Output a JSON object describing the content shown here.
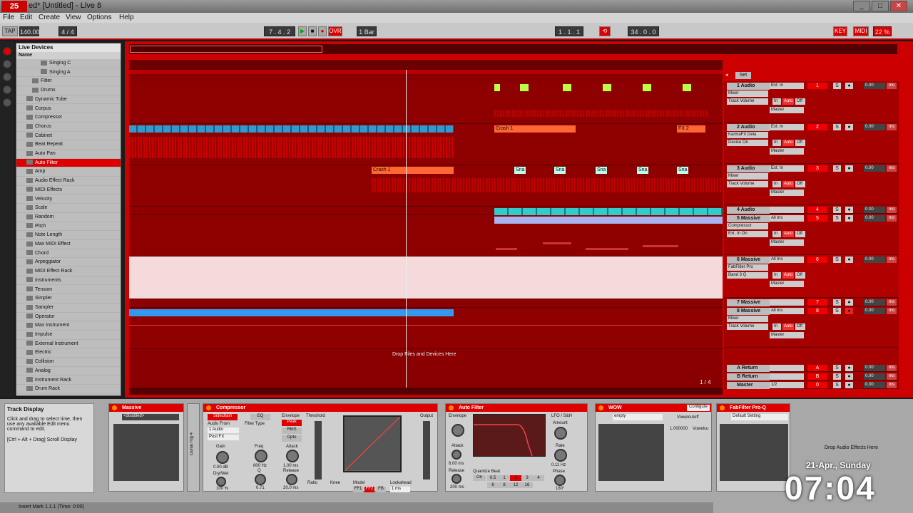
{
  "window": {
    "title": "ed* [Untitled] - Live 8",
    "logo": "25",
    "buttons": [
      "_",
      "□",
      "✕"
    ]
  },
  "menu": [
    "File",
    "Edit",
    "Create",
    "View",
    "Options",
    "Help"
  ],
  "transport": {
    "tap": "TAP",
    "tempo": "140.00",
    "time_sig": "4 / 4",
    "position": "7 . 4 . 2",
    "ovr": "OVR",
    "quantize": "1 Bar",
    "loop_start": "1 . 1 . 1",
    "loop_length": "34 . 0 . 0",
    "key": "KEY",
    "midi": "MIDI",
    "cpu": "22 %"
  },
  "browser": {
    "header": "Live Devices",
    "column": "Name",
    "items": [
      "Singing C",
      "Singing A",
      "Filter",
      "Drums",
      "Dynamic Tube",
      "Corpus",
      "Compressor",
      "Chorus",
      "Cabinet",
      "Beat Repeat",
      "Auto Pan",
      "Auto Filter",
      "Amp",
      "Audio Effect Rack",
      "MIDI Effects",
      "Velocity",
      "Scale",
      "Random",
      "Pitch",
      "Note Length",
      "Max MIDI Effect",
      "Chord",
      "Arpeggiator",
      "MIDI Effect Rack",
      "Instruments",
      "Tension",
      "Simpler",
      "Sampler",
      "Operator",
      "Max Instrument",
      "Impulse",
      "External Instrument",
      "Electric",
      "Collision",
      "Analog",
      "Instrument Rack",
      "Drum Rack"
    ],
    "selected": "Auto Filter"
  },
  "clips": {
    "crash1_a": "Crash 1",
    "crash1_b": "Crash 1",
    "fx2": "FX 2",
    "snare": "Sna"
  },
  "arrangement": {
    "drop_hint": "Drop Files and Devices Here",
    "page": "1 / 4",
    "set": "Set"
  },
  "tracks": [
    {
      "name": "1 Audio",
      "num": "1",
      "io1": "Ext. In",
      "io2": "Mixer",
      "io3": "Track Volume",
      "val": "0.00"
    },
    {
      "name": "2 Audio",
      "num": "2",
      "io1": "Ext. In",
      "io2": "KarmaFX Dela",
      "io3": "Device On",
      "val": "0.00"
    },
    {
      "name": "3 Audio",
      "num": "3",
      "io1": "Ext. In",
      "io2": "Mixer",
      "io3": "Track Volume",
      "val": "0.00"
    },
    {
      "name": "4 Audio",
      "num": "4",
      "io1": "",
      "io2": "",
      "io3": "",
      "val": "0.00"
    },
    {
      "name": "5 Massive",
      "num": "5",
      "io1": "All Ins",
      "io2": "Compressor",
      "io3": "Ext. In On",
      "val": "0.00"
    },
    {
      "name": "6 Massive",
      "num": "6",
      "io1": "All Ins",
      "io2": "FabFilter Pro",
      "io3": "Band 3 Q",
      "val": "0.00"
    },
    {
      "name": "7 Massive",
      "num": "7",
      "io1": "",
      "io2": "",
      "io3": "",
      "val": "0.00"
    },
    {
      "name": "8 Massive",
      "num": "8",
      "io1": "All Ins",
      "io2": "Mixer",
      "io3": "Track Volume",
      "val": "0.00"
    },
    {
      "name": "A Return",
      "num": "A",
      "io1": "",
      "io2": "",
      "io3": "",
      "val": "0.00"
    },
    {
      "name": "B Return",
      "num": "B",
      "io1": "",
      "io2": "",
      "io3": "",
      "val": "0.00"
    },
    {
      "name": "Master",
      "num": "0",
      "io1": "1/2",
      "io2": "",
      "io3": "",
      "val": "0.00"
    }
  ],
  "mixer_labels": {
    "solo": "S",
    "post": "Post",
    "ms": "ms",
    "master_out": "Master",
    "mon_in": "In",
    "mon_auto": "Auto",
    "mon_off": "Off"
  },
  "info_view": {
    "title": "Track Display",
    "text1": "Click and drag to select time, then use any available Edit menu command to edit.",
    "text2": "[Ctrl + Alt + Drag] Scroll Display"
  },
  "devices": {
    "massive": {
      "title": "Massive",
      "preset": "<disabled>"
    },
    "rack": "Guitar Rig 4",
    "compressor": {
      "title": "Compressor",
      "sidechain": "Sidechain",
      "eq": "EQ",
      "audio_from": "Audio From",
      "source": "1 Audio",
      "tap": "Post FX",
      "filter_type": "Filter Type",
      "freq": "Freq",
      "freq_val": "800 Hz",
      "gain": "Gain",
      "gain_val": "0.00 dB",
      "drywet": "Dry/Wet",
      "drywet_val": "100 %",
      "q": "Q",
      "q_val": "0.71",
      "envelope": "Envelope",
      "peak": "Peak",
      "rms": "RMS",
      "opto": "Opto",
      "attack": "Attack",
      "attack_val": "1.00 ms",
      "release": "Release",
      "release_val": "20.0 ms",
      "threshold": "Threshold",
      "output": "Output",
      "ratio": "Ratio",
      "knee": "Knee",
      "model": "Model",
      "lookahead": "Lookahead",
      "ff1": "FF1",
      "ff2": "FF2",
      "fb": "FB",
      "lookahead_val": "1 ms"
    },
    "autofilter": {
      "title": "Auto Filter",
      "envelope": "Envelope",
      "attack": "Attack",
      "release": "Release",
      "attack_val": "6.00 ms",
      "release_val": "200 ms",
      "lfo": "LFO / S&H",
      "amount": "Amount",
      "rate": "Rate",
      "rate_val": "0.11 Hz",
      "phase": "Phase",
      "phase_val": "180°",
      "quantize": "Quantize Beat",
      "on": "On",
      "beats": [
        "0.5",
        "1",
        "2",
        "3",
        "4",
        "6",
        "8",
        "12",
        "16"
      ]
    },
    "wow": {
      "title": "WOW",
      "configure": "Configure",
      "preset": "empty",
      "param_name": "Vowelcutoff",
      "param_val": "1.000000",
      "param_short": "Vowelcu"
    },
    "fabfilter": {
      "title": "FabFilter Pro-Q",
      "preset": "Default Setting"
    },
    "drop_effects": "Drop Audio Effects Here"
  },
  "status": "Insert Mark 1.1.1 (Time: 0:00)",
  "clock": {
    "date": "21-Apr., Sunday",
    "time": "07:04"
  }
}
